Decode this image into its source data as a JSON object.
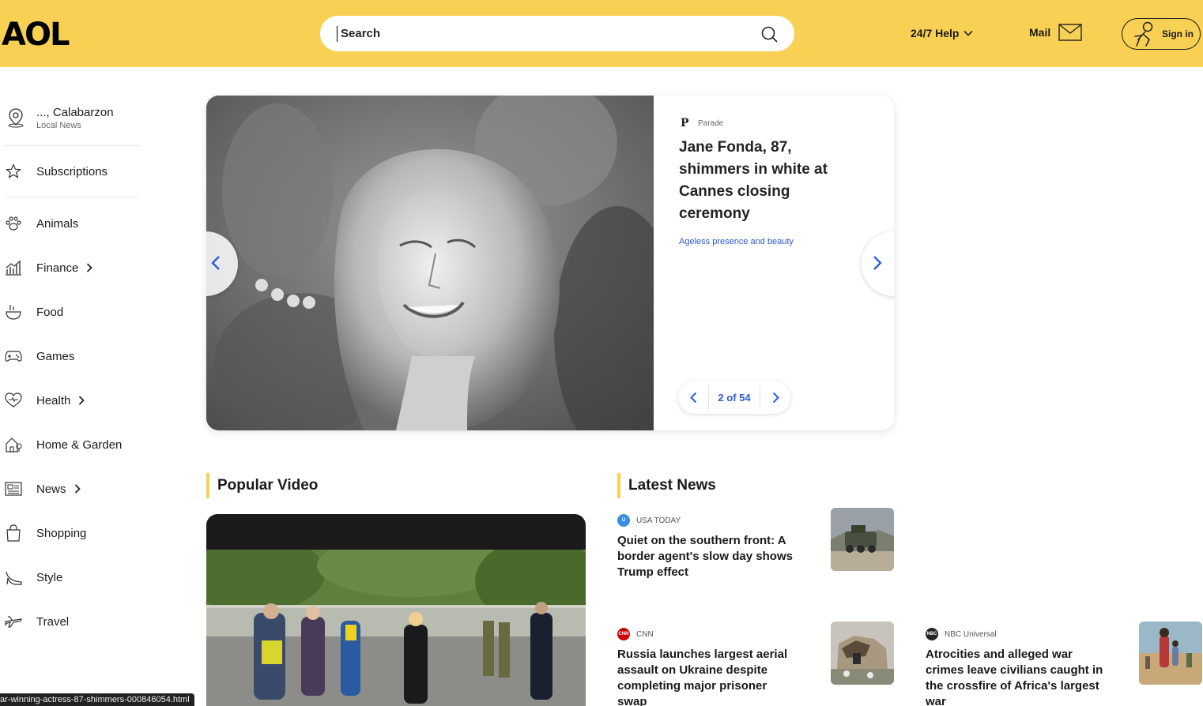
{
  "header": {
    "logo": "AOL",
    "search_placeholder": "Search",
    "help_label": "24/7 Help",
    "mail_label": "Mail",
    "signin_label": "Sign in"
  },
  "sidebar": {
    "location": {
      "name": "..., Calabarzon",
      "sub": "Local News"
    },
    "subscriptions": "Subscriptions",
    "items": [
      {
        "label": "Animals",
        "icon": "paw-icon",
        "has_chevron": false
      },
      {
        "label": "Finance",
        "icon": "finance-chart-icon",
        "has_chevron": true
      },
      {
        "label": "Food",
        "icon": "food-bowl-icon",
        "has_chevron": false
      },
      {
        "label": "Games",
        "icon": "gamepad-icon",
        "has_chevron": false
      },
      {
        "label": "Health",
        "icon": "heart-pulse-icon",
        "has_chevron": true
      },
      {
        "label": "Home & Garden",
        "icon": "home-garden-icon",
        "has_chevron": false
      },
      {
        "label": "News",
        "icon": "newspaper-icon",
        "has_chevron": true
      },
      {
        "label": "Shopping",
        "icon": "shopping-bag-icon",
        "has_chevron": false
      },
      {
        "label": "Style",
        "icon": "high-heel-icon",
        "has_chevron": false
      },
      {
        "label": "Travel",
        "icon": "airplane-icon",
        "has_chevron": false
      }
    ]
  },
  "hero": {
    "source_logo": "P",
    "source": "Parade",
    "title": "Jane Fonda, 87, shimmers in white at Cannes closing ceremony",
    "subtitle": "Ageless presence and beauty",
    "pager": "2 of 54"
  },
  "sections": {
    "popular_video": "Popular Video",
    "latest_news": "Latest News"
  },
  "latest_news": [
    {
      "source": "USA TODAY",
      "title": "Quiet on the southern front: A border agent's slow day shows Trump effect",
      "color": "#3c8fe0"
    },
    {
      "source": "CNN",
      "title": "Russia launches largest aerial assault on Ukraine despite completing major prisoner swap",
      "color": "#cc0000"
    },
    {
      "source": "NBC Universal",
      "title": "Atrocities and alleged war crimes leave civilians caught in the crossfire of Africa's largest war",
      "color": "#222222"
    }
  ],
  "statusbar": "ar-winning-actress-87-shimmers-000846054.html",
  "colors": {
    "brand_yellow": "#f8d154",
    "link_blue": "#2d5bd8"
  }
}
